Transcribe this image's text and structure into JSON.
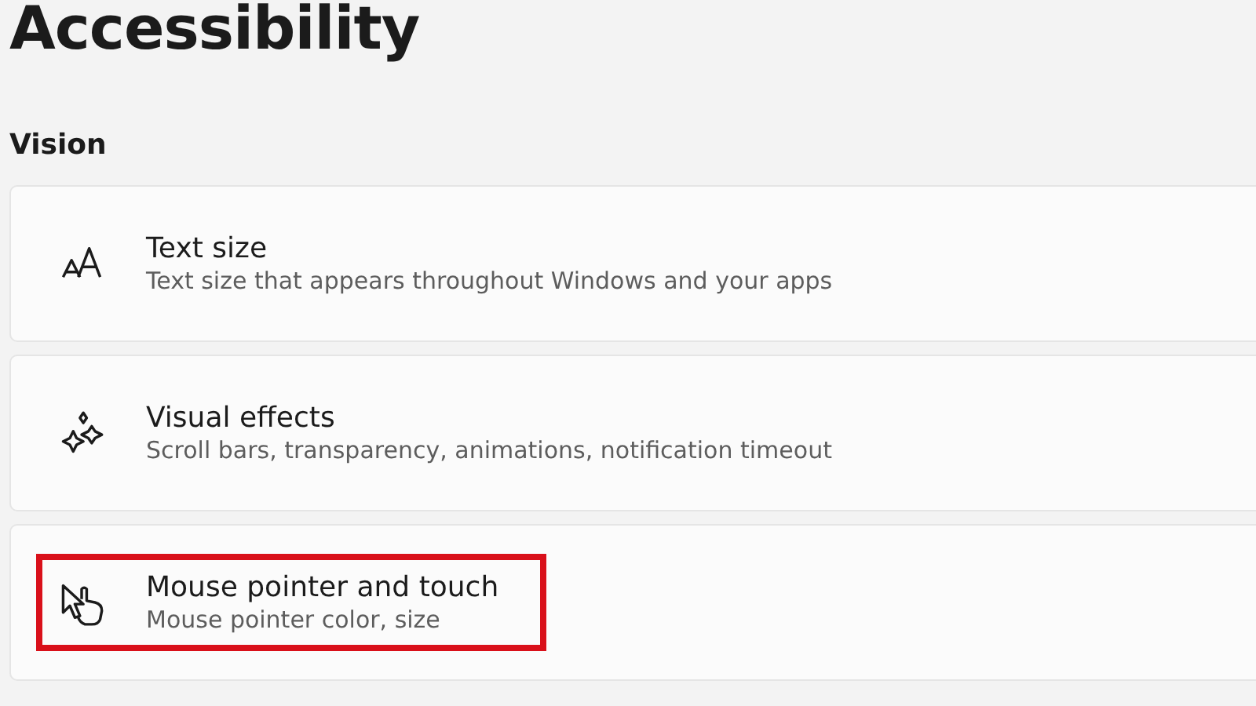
{
  "page_title": "Accessibility",
  "section": "Vision",
  "items": [
    {
      "title": "Text size",
      "subtitle": "Text size that appears throughout Windows and your apps",
      "highlighted": false
    },
    {
      "title": "Visual effects",
      "subtitle": "Scroll bars, transparency, animations, notification timeout",
      "highlighted": false
    },
    {
      "title": "Mouse pointer and touch",
      "subtitle": "Mouse pointer color, size",
      "highlighted": true
    }
  ]
}
